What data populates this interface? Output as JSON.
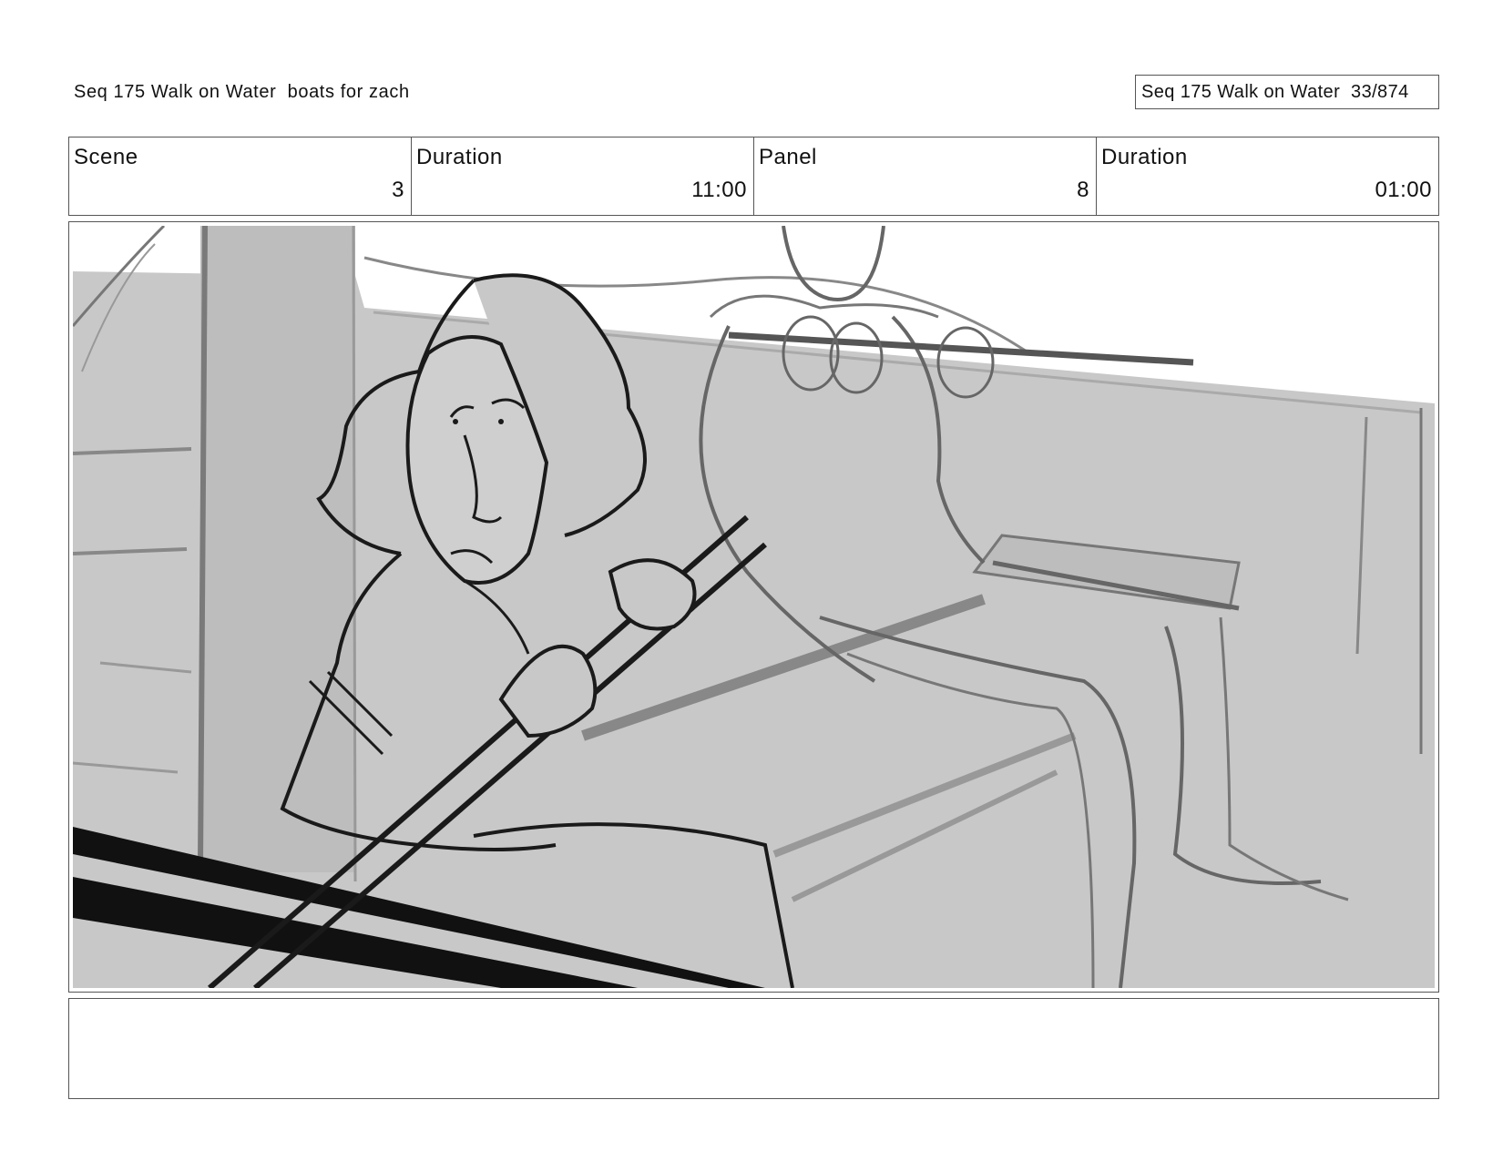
{
  "header": {
    "sequence_title": "Seq 175 Walk on Water  boats for zach",
    "page_indicator": "Seq 175 Walk on Water  33/874"
  },
  "info": {
    "scene_label": "Scene",
    "scene_value": "3",
    "duration_label": "Duration",
    "duration_value": "11:00",
    "panel_label": "Panel",
    "panel_value": "8",
    "panel_duration_label": "Duration",
    "panel_duration_value": "01:00"
  },
  "notes": {
    "text": ""
  },
  "colors": {
    "sketch_bg": "#c8c8c8",
    "sketch_dark": "#1a1a1a",
    "sketch_mid": "#6e6e6e",
    "border": "#555555"
  }
}
